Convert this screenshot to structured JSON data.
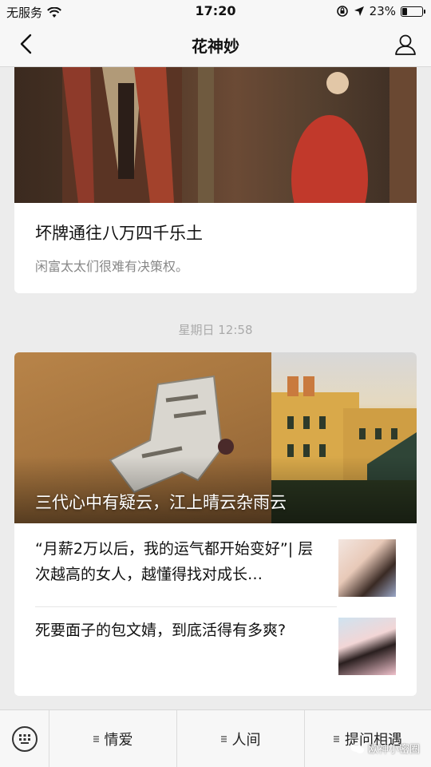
{
  "status_bar": {
    "carrier": "无服务",
    "time": "17:20",
    "battery": "23%",
    "battery_level": 0.23
  },
  "nav": {
    "title": "花神妙"
  },
  "articles": {
    "first": {
      "title": "坏牌通往八万四千乐土",
      "summary": "闲富太太们很难有决策权。"
    },
    "timestamp": "星期日 12:58",
    "second": {
      "hero_title": "三代心中有疑云，江上晴云杂雨云",
      "rows": [
        {
          "text": "“月薪2万以后，我的运气都开始变好”| 层次越高的女人，越懂得找对成长…"
        },
        {
          "text": "死要面子的包文婧，到底活得有多爽?"
        }
      ]
    }
  },
  "bottom_menu": {
    "items": [
      {
        "label": "情爱"
      },
      {
        "label": "人间"
      },
      {
        "label": "提问相遇"
      }
    ]
  },
  "watermark": "欧神小密圈"
}
